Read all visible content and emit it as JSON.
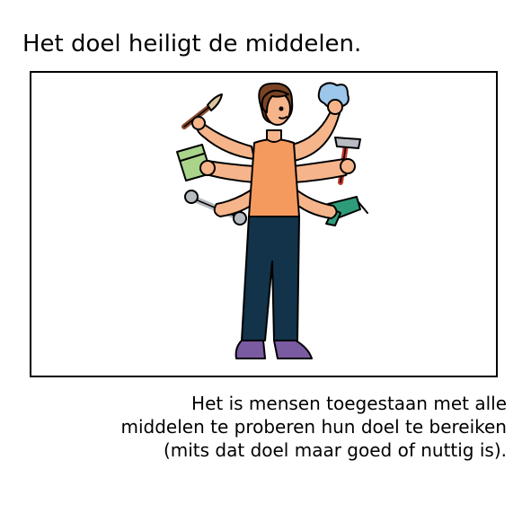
{
  "page": {
    "title": "Het doel heiligt de middelen.",
    "caption_lines": [
      "Het is mensen toegestaan met alle",
      "middelen te proberen hun doel te bereiken",
      "(mits dat doel maar goed of nuttig is)."
    ]
  },
  "illustration": {
    "icons": [
      "person-icon",
      "paintbrush-icon",
      "cloth-icon",
      "notepad-icon",
      "hammer-icon",
      "wrench-icon",
      "drill-icon"
    ],
    "colors": {
      "skin": "#f6b48a",
      "shirt": "#f59a5e",
      "hair": "#7a4424",
      "trousers": "#123349",
      "shoes": "#7a5aa0",
      "cloth": "#9cc6ea",
      "notepad": "#a9d48a",
      "drill": "#2e9c7a",
      "hammer_handle": "#c0392b",
      "tool_grey": "#b8bcc2",
      "brush_handle": "#8a4a2e"
    }
  }
}
